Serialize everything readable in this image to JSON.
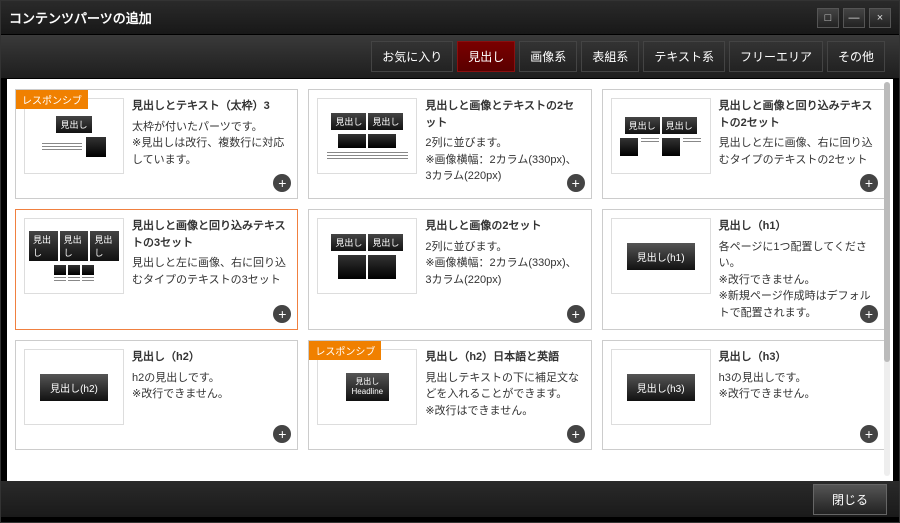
{
  "window": {
    "title": "コンテンツパーツの追加"
  },
  "tabs": [
    {
      "label": "お気に入り"
    },
    {
      "label": "見出し"
    },
    {
      "label": "画像系"
    },
    {
      "label": "表組系"
    },
    {
      "label": "テキスト系"
    },
    {
      "label": "フリーエリア"
    },
    {
      "label": "その他"
    }
  ],
  "badge_responsive": "レスポンシブ",
  "thumb_labels": {
    "midashi": "見出し",
    "headline": "Headline",
    "h1": "見出し(h1)",
    "h2": "見出し(h2)",
    "h3": "見出し(h3)"
  },
  "cards": [
    {
      "title": "見出しとテキスト（太枠）3",
      "desc": "太枠が付いたパーツです。\n※見出しは改行、複数行に対応しています。",
      "responsive": true
    },
    {
      "title": "見出しと画像とテキストの2セット",
      "desc": "2列に並びます。\n※画像横幅：2カラム(330px)、3カラム(220px)"
    },
    {
      "title": "見出しと画像と回り込みテキストの2セット",
      "desc": "見出しと左に画像、右に回り込むタイプのテキストの2セット"
    },
    {
      "title": "見出しと画像と回り込みテキストの3セット",
      "desc": "見出しと左に画像、右に回り込むタイプのテキストの3セット",
      "highlighted": true
    },
    {
      "title": "見出しと画像の2セット",
      "desc": "2列に並びます。\n※画像横幅：2カラム(330px)、3カラム(220px)"
    },
    {
      "title": "見出し（h1）",
      "desc": "各ページに1つ配置してください。\n※改行できません。\n※新規ページ作成時はデフォルトで配置されます。"
    },
    {
      "title": "見出し（h2）",
      "desc": "h2の見出しです。\n※改行できません。"
    },
    {
      "title": "見出し（h2）日本語と英語",
      "desc": "見出しテキストの下に補足文などを入れることができます。\n※改行はできません。",
      "responsive": true
    },
    {
      "title": "見出し（h3）",
      "desc": "h3の見出しです。\n※改行できません。"
    }
  ],
  "footer": {
    "close": "閉じる"
  }
}
